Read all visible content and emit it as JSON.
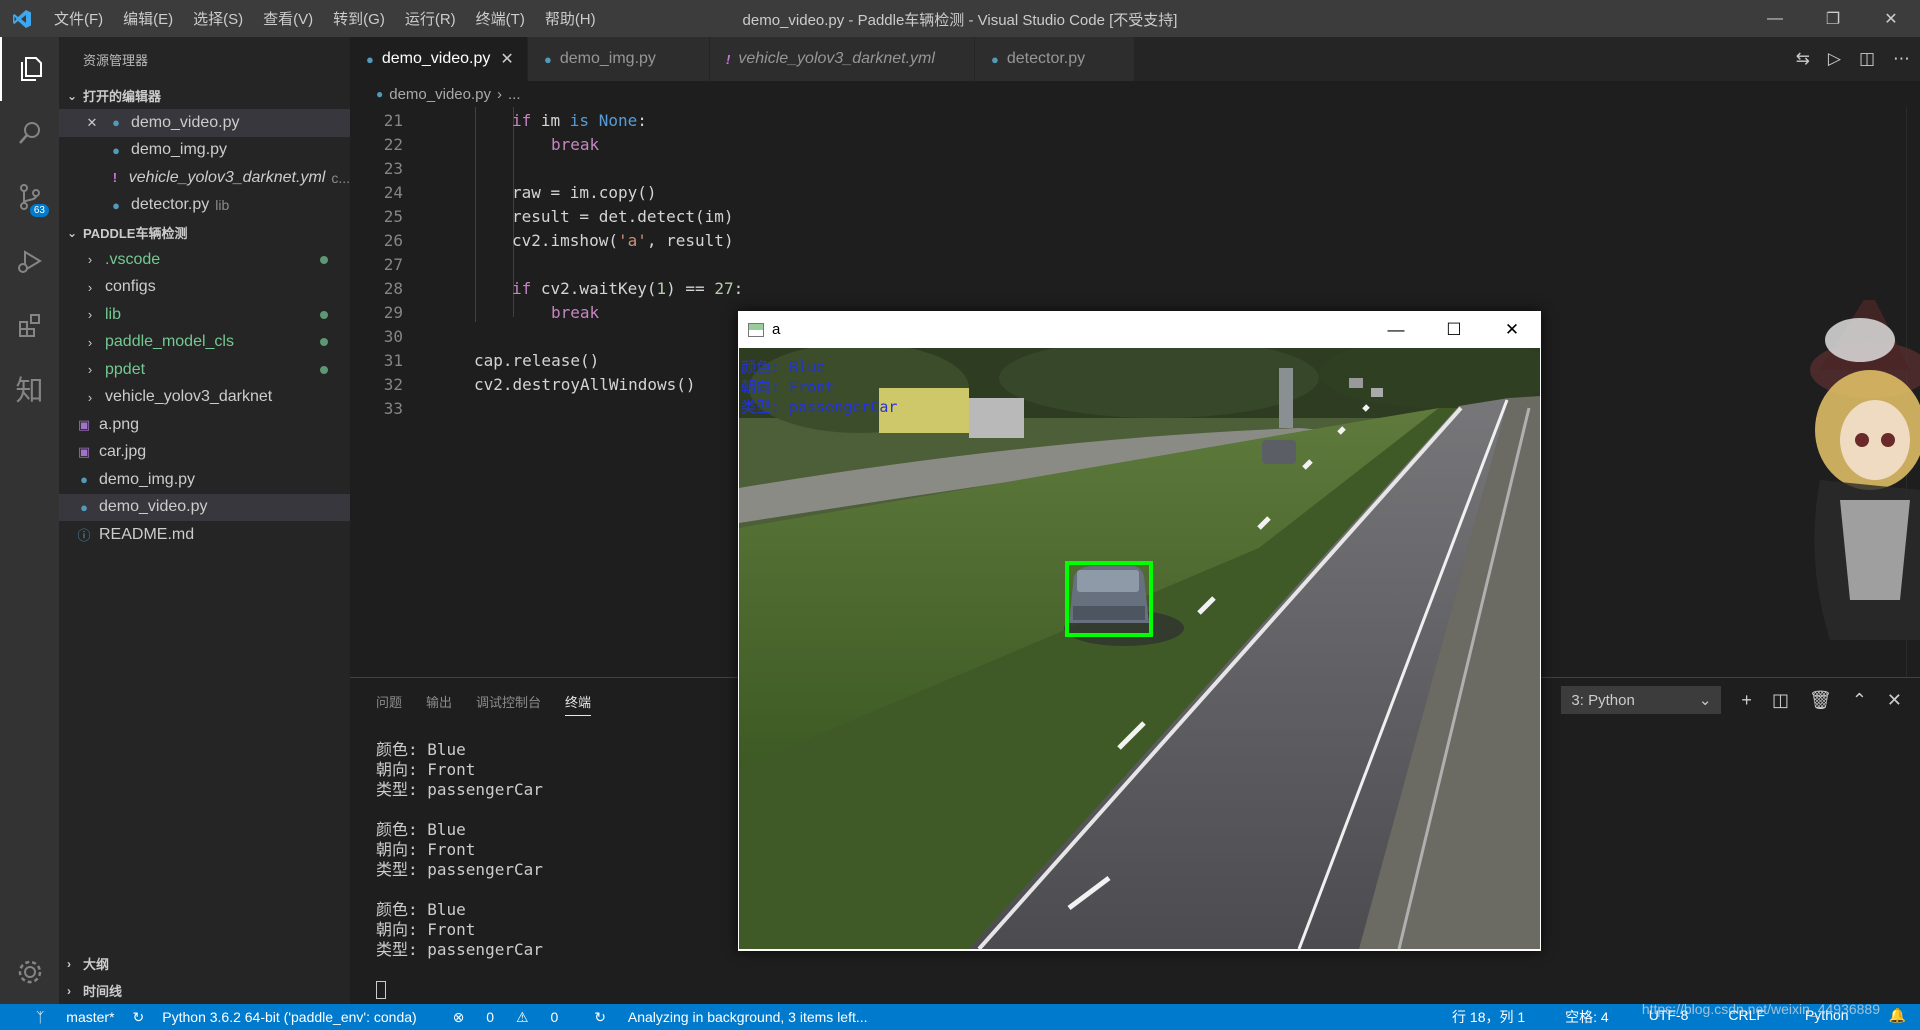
{
  "titlebar": {
    "menu": [
      "文件(F)",
      "编辑(E)",
      "选择(S)",
      "查看(V)",
      "转到(G)",
      "运行(R)",
      "终端(T)",
      "帮助(H)"
    ],
    "title": "demo_video.py - Paddle车辆检测 - Visual Studio Code [不受支持]"
  },
  "activity": {
    "badge": "63",
    "zhi": "知"
  },
  "sidebar": {
    "title": "资源管理器",
    "open_editors_header": "打开的编辑器",
    "open_editors": [
      {
        "name": "demo_video.py",
        "type": "py"
      },
      {
        "name": "demo_img.py",
        "type": "py"
      },
      {
        "name": "vehicle_yolov3_darknet.yml",
        "suffix": "c...",
        "type": "yml"
      },
      {
        "name": "detector.py",
        "suffix": "lib",
        "type": "py"
      }
    ],
    "project_header": "PADDLE车辆检测",
    "tree": [
      {
        "name": ".vscode",
        "kind": "folder",
        "modified": true
      },
      {
        "name": "configs",
        "kind": "folder",
        "modified": false
      },
      {
        "name": "lib",
        "kind": "folder",
        "modified": true
      },
      {
        "name": "paddle_model_cls",
        "kind": "folder",
        "modified": true
      },
      {
        "name": "ppdet",
        "kind": "folder",
        "modified": true
      },
      {
        "name": "vehicle_yolov3_darknet",
        "kind": "folder",
        "modified": false
      },
      {
        "name": "a.png",
        "kind": "img"
      },
      {
        "name": "car.jpg",
        "kind": "img"
      },
      {
        "name": "demo_img.py",
        "kind": "py"
      },
      {
        "name": "demo_video.py",
        "kind": "py"
      },
      {
        "name": "README.md",
        "kind": "info"
      }
    ],
    "outline": "大纲",
    "timeline": "时间线"
  },
  "tabs": [
    {
      "label": "demo_video.py",
      "active": true
    },
    {
      "label": "demo_img.py",
      "active": false
    },
    {
      "label": "vehicle_yolov3_darknet.yml",
      "active": false
    },
    {
      "label": "detector.py",
      "active": false
    }
  ],
  "breadcrumb": {
    "file": "demo_video.py",
    "rest": "..."
  },
  "editor": {
    "line_numbers": [
      "21",
      "22",
      "23",
      "24",
      "25",
      "26",
      "27",
      "28",
      "29",
      "30",
      "31",
      "32",
      "33"
    ]
  },
  "panel": {
    "tabs": [
      "问题",
      "输出",
      "调试控制台",
      "终端"
    ],
    "terminal_select": "3: Python",
    "terminal_lines": [
      "颜色: Blue",
      "朝向: Front",
      "类型: passengerCar",
      "",
      "颜色: Blue",
      "朝向: Front",
      "类型: passengerCar",
      "",
      "颜色: Blue",
      "朝向: Front",
      "类型: passengerCar"
    ]
  },
  "cv_window": {
    "title": "a",
    "overlay": [
      "颜色: Blue",
      "朝向: Front",
      "类型: passengerCar"
    ]
  },
  "status": {
    "branch": "master*",
    "interpreter": "Python 3.6.2 64-bit ('paddle_env': conda)",
    "errors": "0",
    "warnings": "0",
    "analysis": "Analyzing in background, 3 items left...",
    "position": "行 18，列 1",
    "spaces": "空格: 4",
    "encoding": "UTF-8",
    "eol": "CRLF",
    "language": "Python",
    "watermark": "https://blog.csdn.net/weixin_44936889"
  },
  "colors": {
    "accent": "#007acc",
    "bbox": "#00ff00",
    "overlay_text": "#2233dd"
  }
}
